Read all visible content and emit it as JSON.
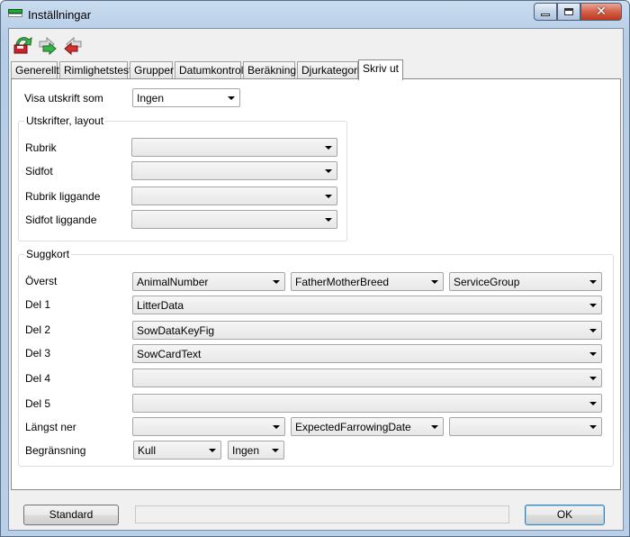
{
  "window": {
    "title": "Inställningar"
  },
  "toolbar": {
    "icons": [
      "save-icon",
      "forward-icon",
      "back-icon"
    ]
  },
  "tabs": [
    "Generellt",
    "Rimlighetstest",
    "Grupper",
    "Datumkontroll",
    "Beräkning",
    "Djurkategori",
    "Skriv ut"
  ],
  "active_tab": "Skriv ut",
  "print_as": {
    "label": "Visa utskrift som",
    "value": "Ingen"
  },
  "layout_group": {
    "title": "Utskrifter, layout",
    "rows": [
      {
        "label": "Rubrik",
        "value": ""
      },
      {
        "label": "Sidfot",
        "value": ""
      },
      {
        "label": "Rubrik liggande",
        "value": ""
      },
      {
        "label": "Sidfot liggande",
        "value": ""
      }
    ]
  },
  "sow_card": {
    "title": "Suggkort",
    "top": {
      "label": "Överst",
      "values": [
        "AnimalNumber",
        "FatherMotherBreed",
        "ServiceGroup"
      ]
    },
    "parts": [
      {
        "label": "Del 1",
        "value": "LitterData"
      },
      {
        "label": "Del 2",
        "value": "SowDataKeyFig"
      },
      {
        "label": "Del 3",
        "value": "SowCardText"
      },
      {
        "label": "Del 4",
        "value": ""
      },
      {
        "label": "Del 5",
        "value": ""
      }
    ],
    "bottom": {
      "label": "Längst ner",
      "values": [
        "",
        "ExpectedFarrowingDate",
        ""
      ]
    },
    "limit": {
      "label": "Begränsning",
      "values": [
        "Kull",
        "Ingen"
      ]
    }
  },
  "buttons": {
    "standard": "Standard",
    "ok": "OK"
  },
  "status_text": ""
}
